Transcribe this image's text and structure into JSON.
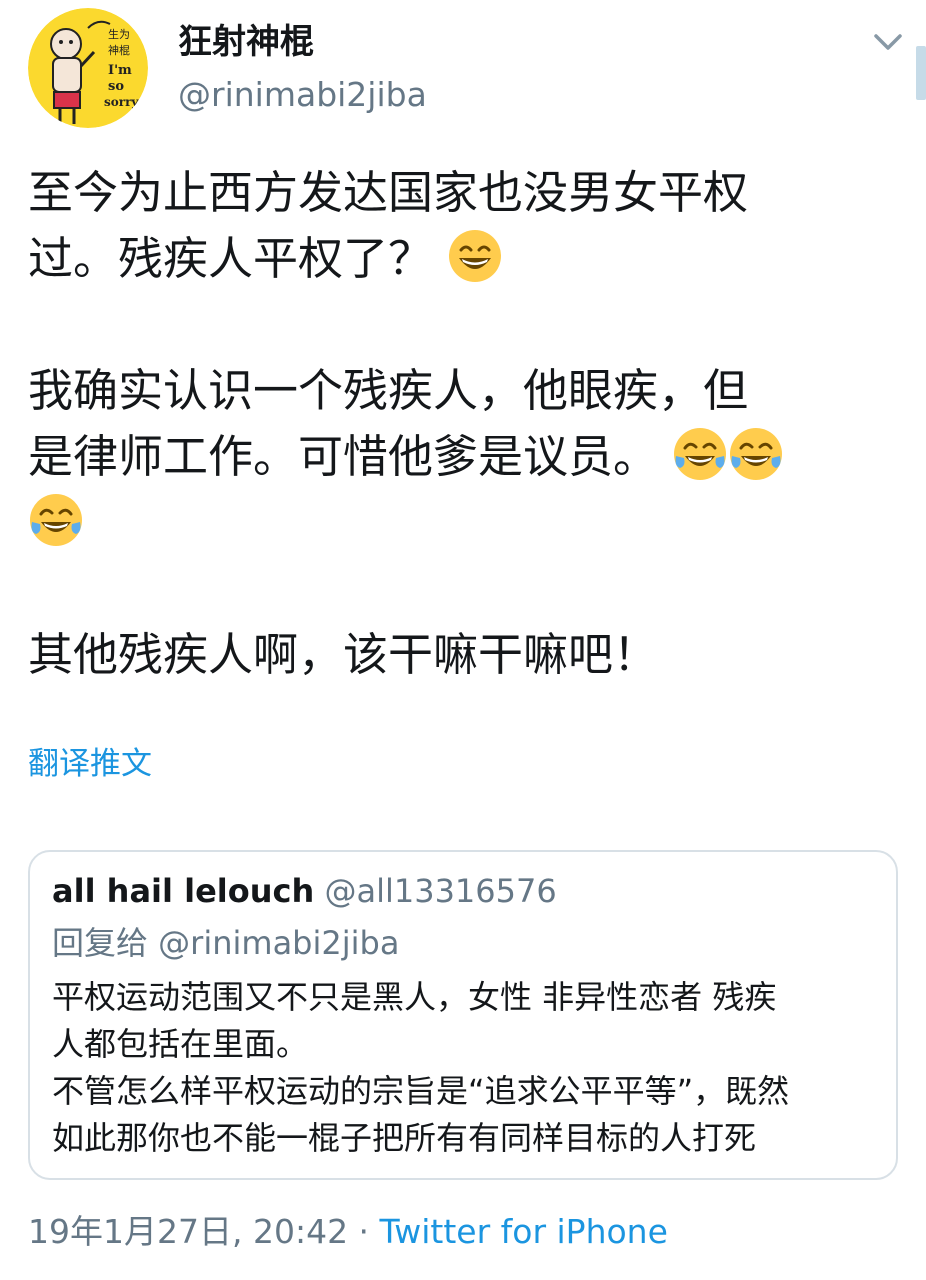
{
  "author": {
    "display_name": "狂射神棍",
    "handle": "@rinimabi2jiba",
    "avatar_text": [
      "生为",
      "神棍",
      "I'm",
      "so",
      "sorry"
    ]
  },
  "tweet": {
    "lines": [
      "至今为止西方发达国家也没男女平权",
      "过。残疾人平权了？",
      "我确实认识一个残疾人，他眼疾，但",
      "是律师工作。可惜他爹是议员。",
      "其他残疾人啊，该干嘛干嘛吧！"
    ],
    "emojis": [
      "grinning-face-emoji",
      "tears-of-joy-emoji",
      "tears-of-joy-emoji",
      "tears-of-joy-emoji"
    ]
  },
  "translate_label": "翻译推文",
  "quote": {
    "name": "all hail lelouch",
    "handle": "@all13316576",
    "reply_to": "回复给 @rinimabi2jiba",
    "lines": [
      "平权运动范围又不只是黑人，女性 非异性恋者 残疾",
      "人都包括在里面。",
      "不管怎么样平权运动的宗旨是“追求公平平等”，既然",
      "如此那你也不能一棍子把所有有同样目标的人打死"
    ]
  },
  "meta": {
    "timestamp": "19年1月27日, 20:42",
    "separator": " · ",
    "source": "Twitter for iPhone"
  },
  "colors": {
    "link": "#1b95e0",
    "secondary_text": "#657786",
    "primary_text": "#14171a",
    "card_border": "#d8e0e6",
    "avatar_background": "#fbd92e"
  }
}
